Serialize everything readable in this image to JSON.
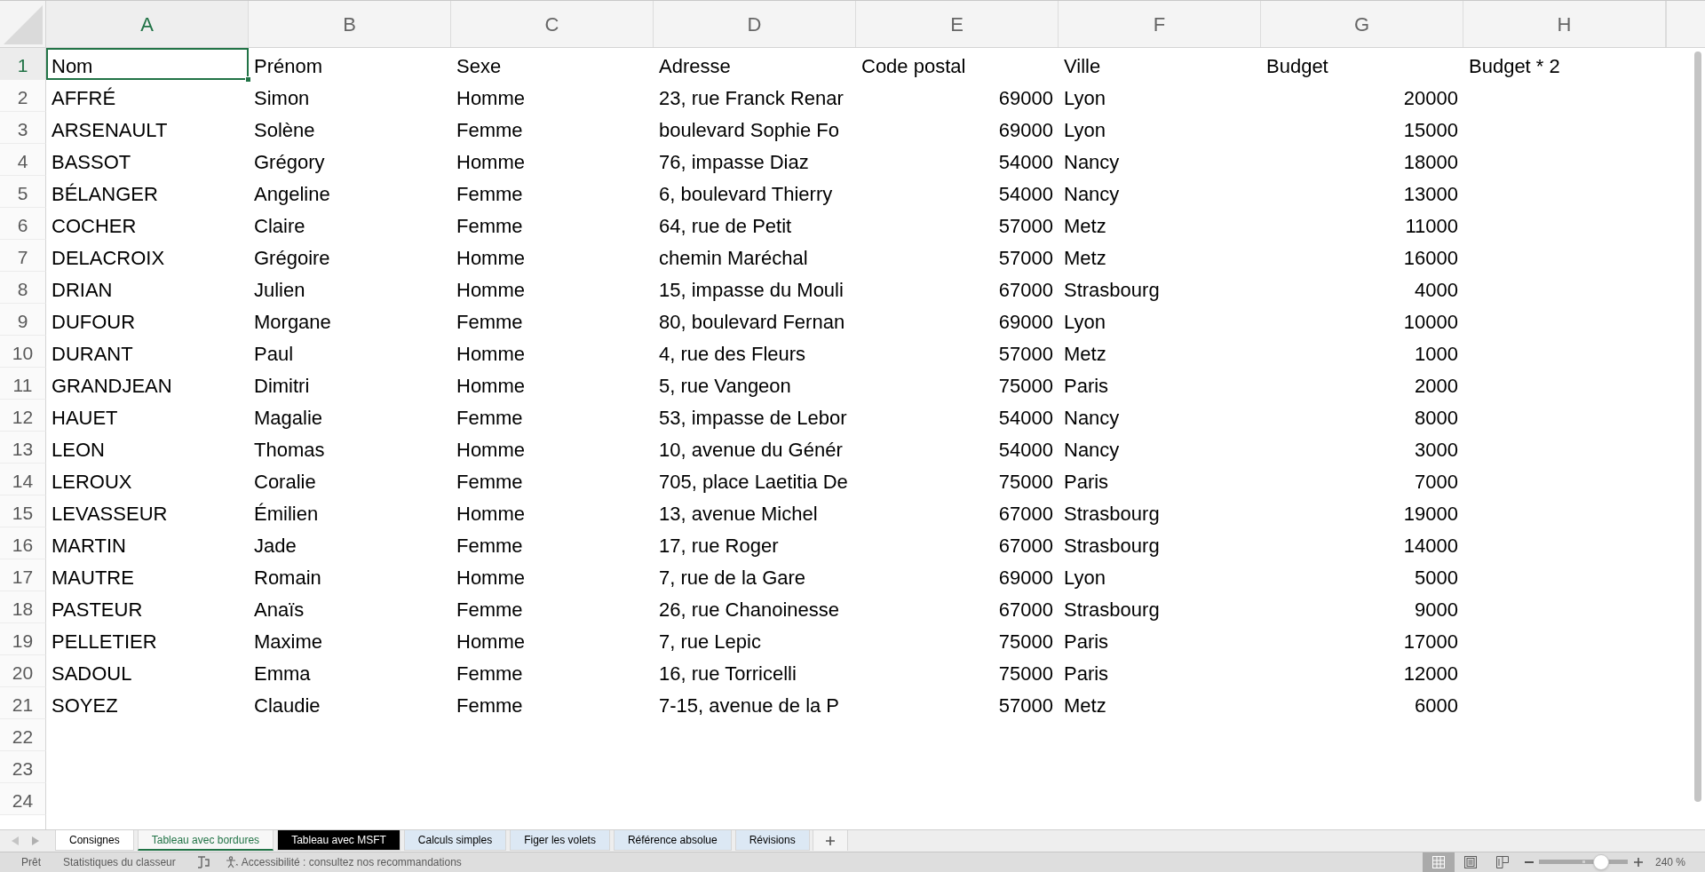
{
  "sheet": {
    "columns": [
      {
        "label": "A",
        "selected": true
      },
      {
        "label": "B",
        "selected": false
      },
      {
        "label": "C",
        "selected": false
      },
      {
        "label": "D",
        "selected": false
      },
      {
        "label": "E",
        "selected": false
      },
      {
        "label": "F",
        "selected": false
      },
      {
        "label": "G",
        "selected": false
      },
      {
        "label": "H",
        "selected": false
      }
    ],
    "rows": [
      {
        "label": "1",
        "selected": true,
        "cells": [
          {
            "text": "Nom",
            "kind": "text"
          },
          {
            "text": "Prénom",
            "kind": "text"
          },
          {
            "text": "Sexe",
            "kind": "text"
          },
          {
            "text": "Adresse",
            "kind": "text"
          },
          {
            "text": "Code postal",
            "kind": "text"
          },
          {
            "text": "Ville",
            "kind": "text"
          },
          {
            "text": "Budget",
            "kind": "text"
          },
          {
            "text": "Budget * 2",
            "kind": "text"
          }
        ]
      },
      {
        "label": "2",
        "selected": false,
        "cells": [
          {
            "text": "AFFRÉ",
            "kind": "text"
          },
          {
            "text": "Simon",
            "kind": "text"
          },
          {
            "text": "Homme",
            "kind": "text"
          },
          {
            "text": "23, rue Franck Renar",
            "kind": "text"
          },
          {
            "text": "69000",
            "kind": "number"
          },
          {
            "text": "Lyon",
            "kind": "text"
          },
          {
            "text": "20000",
            "kind": "number"
          }
        ]
      },
      {
        "label": "3",
        "selected": false,
        "cells": [
          {
            "text": "ARSENAULT",
            "kind": "text"
          },
          {
            "text": "Solène",
            "kind": "text"
          },
          {
            "text": "Femme",
            "kind": "text"
          },
          {
            "text": "boulevard Sophie Fo",
            "kind": "text"
          },
          {
            "text": "69000",
            "kind": "number"
          },
          {
            "text": "Lyon",
            "kind": "text"
          },
          {
            "text": "15000",
            "kind": "number"
          }
        ]
      },
      {
        "label": "4",
        "selected": false,
        "cells": [
          {
            "text": "BASSOT",
            "kind": "text"
          },
          {
            "text": "Grégory",
            "kind": "text"
          },
          {
            "text": "Homme",
            "kind": "text"
          },
          {
            "text": "76, impasse Diaz",
            "kind": "text"
          },
          {
            "text": "54000",
            "kind": "number"
          },
          {
            "text": "Nancy",
            "kind": "text"
          },
          {
            "text": "18000",
            "kind": "number"
          }
        ]
      },
      {
        "label": "5",
        "selected": false,
        "cells": [
          {
            "text": "BÉLANGER",
            "kind": "text"
          },
          {
            "text": "Angeline",
            "kind": "text"
          },
          {
            "text": "Femme",
            "kind": "text"
          },
          {
            "text": "6, boulevard Thierry",
            "kind": "text"
          },
          {
            "text": "54000",
            "kind": "number"
          },
          {
            "text": "Nancy",
            "kind": "text"
          },
          {
            "text": "13000",
            "kind": "number"
          }
        ]
      },
      {
        "label": "6",
        "selected": false,
        "cells": [
          {
            "text": "COCHER",
            "kind": "text"
          },
          {
            "text": "Claire",
            "kind": "text"
          },
          {
            "text": "Femme",
            "kind": "text"
          },
          {
            "text": "64, rue de Petit",
            "kind": "text"
          },
          {
            "text": "57000",
            "kind": "number"
          },
          {
            "text": "Metz",
            "kind": "text"
          },
          {
            "text": "11000",
            "kind": "number"
          }
        ]
      },
      {
        "label": "7",
        "selected": false,
        "cells": [
          {
            "text": "DELACROIX",
            "kind": "text"
          },
          {
            "text": "Grégoire",
            "kind": "text"
          },
          {
            "text": "Homme",
            "kind": "text"
          },
          {
            "text": "chemin Maréchal",
            "kind": "text"
          },
          {
            "text": "57000",
            "kind": "number"
          },
          {
            "text": "Metz",
            "kind": "text"
          },
          {
            "text": "16000",
            "kind": "number"
          }
        ]
      },
      {
        "label": "8",
        "selected": false,
        "cells": [
          {
            "text": "DRIAN",
            "kind": "text"
          },
          {
            "text": "Julien",
            "kind": "text"
          },
          {
            "text": "Homme",
            "kind": "text"
          },
          {
            "text": "15, impasse du Mouli",
            "kind": "text"
          },
          {
            "text": "67000",
            "kind": "number"
          },
          {
            "text": "Strasbourg",
            "kind": "text"
          },
          {
            "text": "4000",
            "kind": "number"
          }
        ]
      },
      {
        "label": "9",
        "selected": false,
        "cells": [
          {
            "text": "DUFOUR",
            "kind": "text"
          },
          {
            "text": "Morgane",
            "kind": "text"
          },
          {
            "text": "Femme",
            "kind": "text"
          },
          {
            "text": "80, boulevard Fernan",
            "kind": "text"
          },
          {
            "text": "69000",
            "kind": "number"
          },
          {
            "text": "Lyon",
            "kind": "text"
          },
          {
            "text": "10000",
            "kind": "number"
          }
        ]
      },
      {
        "label": "10",
        "selected": false,
        "cells": [
          {
            "text": "DURANT",
            "kind": "text"
          },
          {
            "text": "Paul",
            "kind": "text"
          },
          {
            "text": "Homme",
            "kind": "text"
          },
          {
            "text": "4, rue des Fleurs",
            "kind": "text"
          },
          {
            "text": "57000",
            "kind": "number"
          },
          {
            "text": "Metz",
            "kind": "text"
          },
          {
            "text": "1000",
            "kind": "number"
          }
        ]
      },
      {
        "label": "11",
        "selected": false,
        "cells": [
          {
            "text": "GRANDJEAN",
            "kind": "text"
          },
          {
            "text": "Dimitri",
            "kind": "text"
          },
          {
            "text": "Homme",
            "kind": "text"
          },
          {
            "text": "5, rue Vangeon",
            "kind": "text"
          },
          {
            "text": "75000",
            "kind": "number"
          },
          {
            "text": "Paris",
            "kind": "text"
          },
          {
            "text": "2000",
            "kind": "number"
          }
        ]
      },
      {
        "label": "12",
        "selected": false,
        "cells": [
          {
            "text": "HAUET",
            "kind": "text"
          },
          {
            "text": "Magalie",
            "kind": "text"
          },
          {
            "text": "Femme",
            "kind": "text"
          },
          {
            "text": "53, impasse de Lebor",
            "kind": "text"
          },
          {
            "text": "54000",
            "kind": "number"
          },
          {
            "text": "Nancy",
            "kind": "text"
          },
          {
            "text": "8000",
            "kind": "number"
          }
        ]
      },
      {
        "label": "13",
        "selected": false,
        "cells": [
          {
            "text": "LEON",
            "kind": "text"
          },
          {
            "text": "Thomas",
            "kind": "text"
          },
          {
            "text": "Homme",
            "kind": "text"
          },
          {
            "text": "10, avenue du Génér",
            "kind": "text"
          },
          {
            "text": "54000",
            "kind": "number"
          },
          {
            "text": "Nancy",
            "kind": "text"
          },
          {
            "text": "3000",
            "kind": "number"
          }
        ]
      },
      {
        "label": "14",
        "selected": false,
        "cells": [
          {
            "text": "LEROUX",
            "kind": "text"
          },
          {
            "text": "Coralie",
            "kind": "text"
          },
          {
            "text": "Femme",
            "kind": "text"
          },
          {
            "text": "705, place Laetitia De",
            "kind": "text"
          },
          {
            "text": "75000",
            "kind": "number"
          },
          {
            "text": "Paris",
            "kind": "text"
          },
          {
            "text": "7000",
            "kind": "number"
          }
        ]
      },
      {
        "label": "15",
        "selected": false,
        "cells": [
          {
            "text": "LEVASSEUR",
            "kind": "text"
          },
          {
            "text": "Émilien",
            "kind": "text"
          },
          {
            "text": "Homme",
            "kind": "text"
          },
          {
            "text": "13, avenue Michel",
            "kind": "text"
          },
          {
            "text": "67000",
            "kind": "number"
          },
          {
            "text": "Strasbourg",
            "kind": "text"
          },
          {
            "text": "19000",
            "kind": "number"
          }
        ]
      },
      {
        "label": "16",
        "selected": false,
        "cells": [
          {
            "text": "MARTIN",
            "kind": "text"
          },
          {
            "text": "Jade",
            "kind": "text"
          },
          {
            "text": "Femme",
            "kind": "text"
          },
          {
            "text": "17, rue Roger",
            "kind": "text"
          },
          {
            "text": "67000",
            "kind": "number"
          },
          {
            "text": "Strasbourg",
            "kind": "text"
          },
          {
            "text": "14000",
            "kind": "number"
          }
        ]
      },
      {
        "label": "17",
        "selected": false,
        "cells": [
          {
            "text": "MAUTRE",
            "kind": "text"
          },
          {
            "text": "Romain",
            "kind": "text"
          },
          {
            "text": "Homme",
            "kind": "text"
          },
          {
            "text": "7, rue de la Gare",
            "kind": "text"
          },
          {
            "text": "69000",
            "kind": "number"
          },
          {
            "text": "Lyon",
            "kind": "text"
          },
          {
            "text": "5000",
            "kind": "number"
          }
        ]
      },
      {
        "label": "18",
        "selected": false,
        "cells": [
          {
            "text": "PASTEUR",
            "kind": "text"
          },
          {
            "text": "Anaïs",
            "kind": "text"
          },
          {
            "text": "Femme",
            "kind": "text"
          },
          {
            "text": "26, rue Chanoinesse",
            "kind": "text"
          },
          {
            "text": "67000",
            "kind": "number"
          },
          {
            "text": "Strasbourg",
            "kind": "text"
          },
          {
            "text": "9000",
            "kind": "number"
          }
        ]
      },
      {
        "label": "19",
        "selected": false,
        "cells": [
          {
            "text": "PELLETIER",
            "kind": "text"
          },
          {
            "text": "Maxime",
            "kind": "text"
          },
          {
            "text": "Homme",
            "kind": "text"
          },
          {
            "text": "7, rue Lepic",
            "kind": "text"
          },
          {
            "text": "75000",
            "kind": "number"
          },
          {
            "text": "Paris",
            "kind": "text"
          },
          {
            "text": "17000",
            "kind": "number"
          }
        ]
      },
      {
        "label": "20",
        "selected": false,
        "cells": [
          {
            "text": "SADOUL",
            "kind": "text"
          },
          {
            "text": "Emma",
            "kind": "text"
          },
          {
            "text": "Femme",
            "kind": "text"
          },
          {
            "text": "16, rue Torricelli",
            "kind": "text"
          },
          {
            "text": "75000",
            "kind": "number"
          },
          {
            "text": "Paris",
            "kind": "text"
          },
          {
            "text": "12000",
            "kind": "number"
          }
        ]
      },
      {
        "label": "21",
        "selected": false,
        "cells": [
          {
            "text": "SOYEZ",
            "kind": "text"
          },
          {
            "text": "Claudie",
            "kind": "text"
          },
          {
            "text": "Femme",
            "kind": "text"
          },
          {
            "text": "7-15, avenue de la P",
            "kind": "text"
          },
          {
            "text": "57000",
            "kind": "number"
          },
          {
            "text": "Metz",
            "kind": "text"
          },
          {
            "text": "6000",
            "kind": "number"
          }
        ]
      },
      {
        "label": "22",
        "selected": false
      },
      {
        "label": "23",
        "selected": false
      },
      {
        "label": "24",
        "selected": false
      }
    ]
  },
  "sheet_tabs": [
    {
      "label": "Consignes",
      "selected": false,
      "color": "#ffffff"
    },
    {
      "label": "Tableau avec bordures",
      "selected": true,
      "color": "#f7f7f7"
    },
    {
      "label": "Tableau avec MSFT",
      "selected": false,
      "color": "#000000"
    },
    {
      "label": "Calculs simples",
      "selected": false,
      "color": "#dce8f4"
    },
    {
      "label": "Figer les volets",
      "selected": false,
      "color": "#dce8f4"
    },
    {
      "label": "Référence absolue",
      "selected": false,
      "color": "#dce8f4"
    },
    {
      "label": "Révisions",
      "selected": false,
      "color": "#dce8f4"
    }
  ],
  "status_bar": {
    "mode": "Prêt",
    "statistics": "Statistiques du classeur",
    "accessibility": "Accessibilité : consultez nos recommandations",
    "views": [
      {
        "kind": "normal",
        "selected": true
      },
      {
        "kind": "page_layout",
        "selected": false
      },
      {
        "kind": "page_break",
        "selected": false
      }
    ],
    "zoom": {
      "level": 0.7,
      "label": "240 %"
    }
  }
}
